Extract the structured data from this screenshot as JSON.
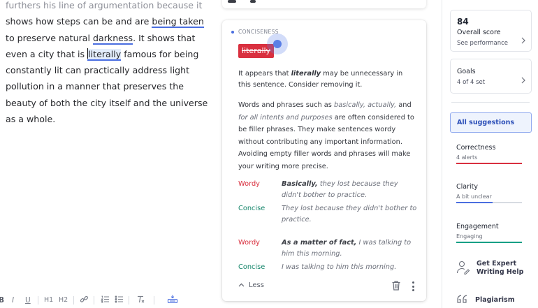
{
  "editor": {
    "lines": [
      "furthers his line of argumentation because it",
      "shows how steps can be and are",
      "being taken",
      "to preserve natural",
      "darkness",
      ". It shows that",
      "even a city that is",
      "literally",
      "famous for being",
      "constantly lit can practically address light",
      "pollution in a manner that preserves the",
      "beauty of both the city itself and the universe",
      "as a whole."
    ],
    "toolbar": [
      "B",
      "I",
      "U",
      "H1",
      "H2",
      "link-icon",
      "numbered-list-icon",
      "bullet-list-icon",
      "clear-format-icon",
      "keyboard-icon"
    ]
  },
  "card": {
    "category": "CONCISENESS",
    "flagged_word": "literally",
    "intro_pre": "It appears that ",
    "intro_word": "literally",
    "intro_post": " may be unnecessary in this sentence. Consider removing it.",
    "body_1": "Words and phrases such as ",
    "body_ex1": "basically, actually,",
    "body_2": " and ",
    "body_ex2": "for all intents and purposes",
    "body_3": " are often considered to be filler phrases. They make sentences wordy without contributing any important information. Avoiding empty filler words and phrases will make your writing more precise.",
    "examples": [
      {
        "label": "Wordy",
        "bold": "Basically,",
        "text": " they lost because they didn't bother to practice."
      },
      {
        "label": "Concise",
        "bold": "",
        "text": "They lost because they didn't bother to practice."
      },
      {
        "label": "Wordy",
        "bold": "As a matter of fact,",
        "text": " I was talking to him this morning."
      },
      {
        "label": "Concise",
        "bold": "",
        "text": "I was talking to him this morning."
      }
    ],
    "less_label": "Less",
    "colors": {
      "alert": "#d9303f",
      "concise": "#16866b",
      "accent": "#4a6ee0"
    }
  },
  "sidebar": {
    "score": "84",
    "score_label": "Overall score",
    "score_link": "See performance",
    "goals_label": "Goals",
    "goals_sub": "4 of 4 set",
    "all_suggestions": "All suggestions",
    "categories": [
      {
        "title": "Correctness",
        "sub": "4 alerts",
        "color": "#d9303f",
        "fill": 1.0
      },
      {
        "title": "Clarity",
        "sub": "A bit unclear",
        "color": "#4a6ee0",
        "fill": 0.55
      },
      {
        "title": "Engagement",
        "sub": "Engaging",
        "color": "#16a085",
        "fill": 1.0
      }
    ],
    "expert_line1": "Get Expert",
    "expert_line2": "Writing Help",
    "plagiarism": "Plagiarism"
  }
}
